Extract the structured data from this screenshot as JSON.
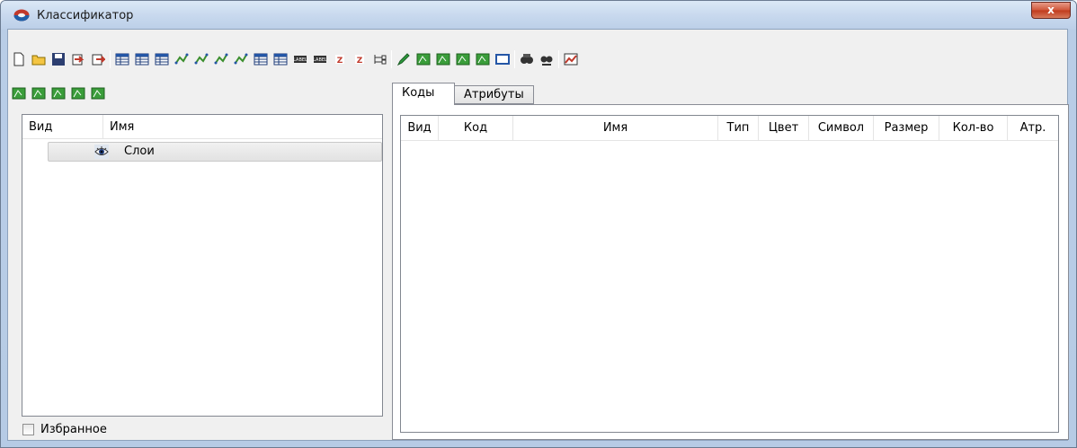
{
  "window": {
    "title": "Классификатор",
    "close_label": "x"
  },
  "toolbar": {
    "row1_icons": [
      "new-file-icon",
      "open-folder-icon",
      "save-icon",
      "import-icon",
      "export-icon",
      "sep",
      "table-props-icon",
      "table-yellow-icon",
      "table-delete-icon",
      "line-style-icon",
      "line-edit-icon",
      "line-delete-icon",
      "line-props-icon",
      "table-add-icon",
      "table-grid-icon",
      "label-icon",
      "label-table-icon",
      "z-icon",
      "z-table-icon",
      "tree-icon",
      "sep",
      "pen-icon",
      "edit-layer-icon",
      "layer-icon",
      "layer-add-icon",
      "layer-remove-icon",
      "frame-icon",
      "sep",
      "search-icon",
      "search-more-icon",
      "sep",
      "chart-icon"
    ],
    "row2_icons": [
      "layer-edit-icon",
      "layer-new-icon",
      "layer-move-icon",
      "layer-check-icon",
      "layer-delete-icon"
    ]
  },
  "layers_grid": {
    "columns": [
      "Вид",
      "Имя"
    ],
    "rows": [
      {
        "label": "Слои"
      }
    ]
  },
  "favorites": {
    "label": "Избранное",
    "checked": false
  },
  "tabs": [
    {
      "label": "Коды",
      "active": true
    },
    {
      "label": "Атрибуты",
      "active": false
    }
  ],
  "codes_grid": {
    "columns": [
      "Вид",
      "Код",
      "Имя",
      "Тип",
      "Цвет",
      "Символ",
      "Размер",
      "Кол-во",
      "Атр."
    ]
  }
}
